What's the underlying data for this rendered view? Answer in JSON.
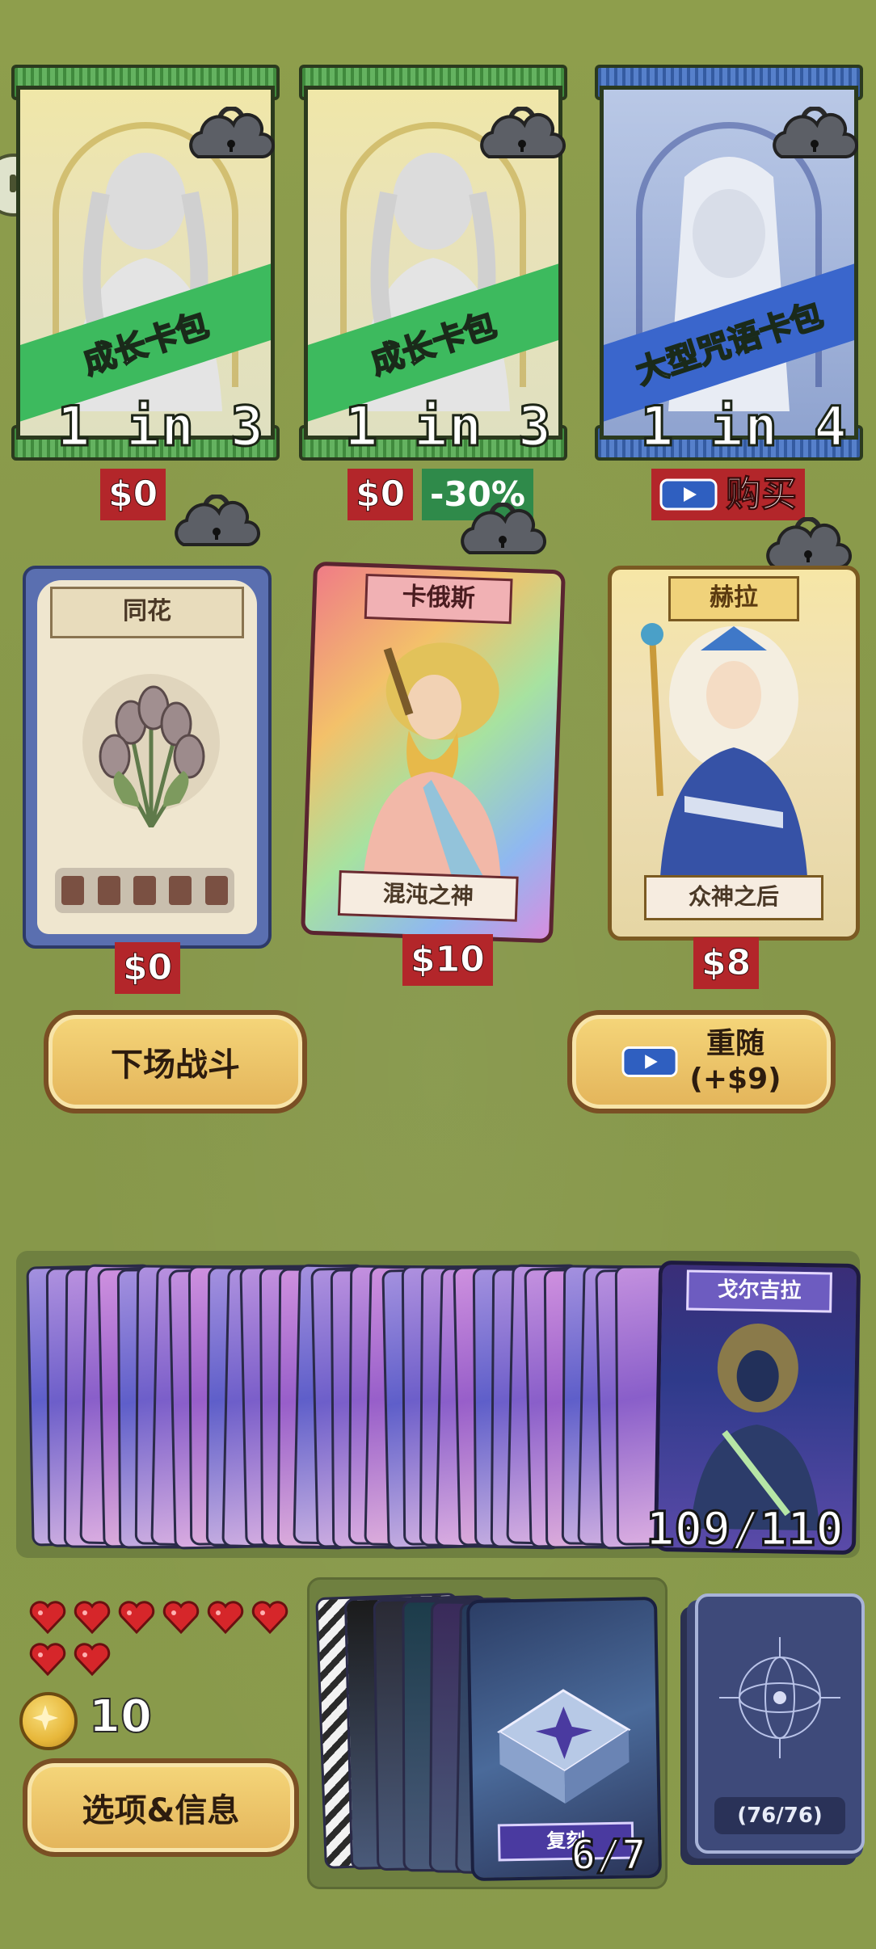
{
  "packs": [
    {
      "name": "成长卡包",
      "odds": "1 in 3",
      "price": "$0",
      "discount": null
    },
    {
      "name": "成长卡包",
      "odds": "1 in 3",
      "price": "$0",
      "discount": "-30%"
    },
    {
      "name": "大型咒语卡包",
      "odds": "1 in 4",
      "buy_label": "购买"
    }
  ],
  "cards": [
    {
      "title": "同花",
      "subtitle": "",
      "price": "$0"
    },
    {
      "title": "卡俄斯",
      "subtitle": "混沌之神",
      "price": "$10"
    },
    {
      "title": "赫拉",
      "subtitle": "众神之后",
      "price": "$8"
    }
  ],
  "buttons": {
    "battle": "下场战斗",
    "reroll_line1": "重随",
    "reroll_line2": "(+$9)",
    "options": "选项&信息"
  },
  "collection": {
    "top_card_title": "戈尔吉拉",
    "counter": "109/110"
  },
  "player": {
    "hearts": 8,
    "coins": "10"
  },
  "hand": {
    "front_card_label": "复刻",
    "counter": "6/7"
  },
  "deck": {
    "counter": "(76/76)"
  },
  "colors": {
    "background": "#8a9a48",
    "price_red": "#b3262a",
    "discount_green": "#2f8a4a",
    "heart_red": "#d6262a",
    "coin_gold": "#e7b73a"
  }
}
